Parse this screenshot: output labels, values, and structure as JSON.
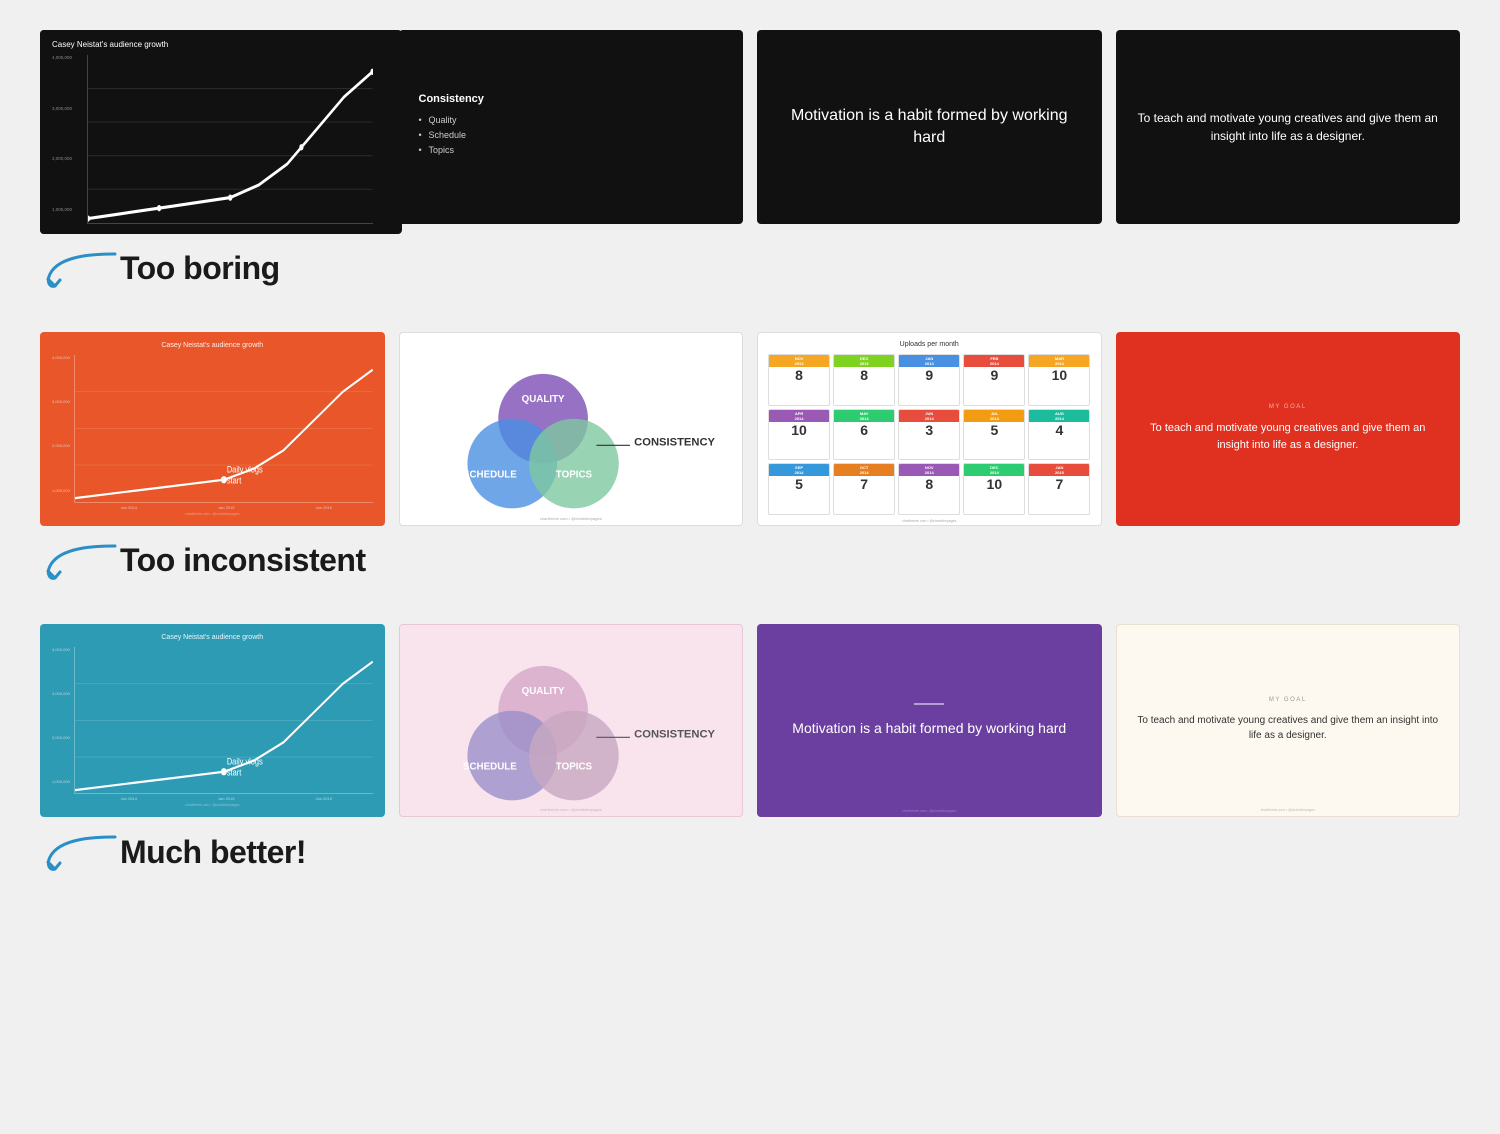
{
  "rows": [
    {
      "id": "row1",
      "slides": [
        {
          "id": "s1-1",
          "type": "chart-black",
          "title": "Casey Neistat's audience growth",
          "yLabels": [
            "4,000,000",
            "3,000,000",
            "2,000,000",
            "1,000,000"
          ]
        },
        {
          "id": "s1-2",
          "type": "bullet-black",
          "title": "Consistency",
          "bullets": [
            "Quality",
            "Schedule",
            "Topics"
          ]
        },
        {
          "id": "s1-3",
          "type": "text-black",
          "text": "Motivation is a habit formed by working hard"
        },
        {
          "id": "s1-4",
          "type": "text-black",
          "text": "To teach and motivate young creatives and give them an insight into life as a designer."
        }
      ],
      "label": "Too boring",
      "labelType": "normal"
    },
    {
      "id": "row2",
      "slides": [
        {
          "id": "s2-1",
          "type": "chart-orange",
          "title": "Casey Neistat's audience growth",
          "dailyLabel": "Daily vlogs start"
        },
        {
          "id": "s2-2",
          "type": "venn-white",
          "labels": [
            "QUALITY",
            "SCHEDULE",
            "TOPICS"
          ],
          "centerLabel": "CONSISTENCY"
        },
        {
          "id": "s2-3",
          "type": "calendar",
          "title": "Uploads per month",
          "cells": [
            {
              "month": "NOV 2013",
              "num": "8",
              "color": "#f5a623"
            },
            {
              "month": "DEC 2013",
              "num": "8",
              "color": "#7ed321"
            },
            {
              "month": "JAN 2014",
              "num": "9",
              "color": "#4a90e2"
            },
            {
              "month": "FEB 2014",
              "num": "9",
              "color": "#e74c3c"
            },
            {
              "month": "MAR 2014",
              "num": "10",
              "color": "#f5a623"
            },
            {
              "month": "APR 2014",
              "num": "10",
              "color": "#9b59b6"
            },
            {
              "month": "MAY 2014",
              "num": "6",
              "color": "#2ecc71"
            },
            {
              "month": "JUN 2014",
              "num": "3",
              "color": "#e74c3c"
            },
            {
              "month": "JUL 2014",
              "num": "5",
              "color": "#f39c12"
            },
            {
              "month": "AUG 2014",
              "num": "4",
              "color": "#1abc9c"
            },
            {
              "month": "SEP 2014",
              "num": "5",
              "color": "#3498db"
            },
            {
              "month": "OCT 2014",
              "num": "7",
              "color": "#e67e22"
            },
            {
              "month": "NOV 2014",
              "num": "8",
              "color": "#9b59b6"
            },
            {
              "month": "DEC 2014",
              "num": "10",
              "color": "#2ecc71"
            },
            {
              "month": "JAN 2015",
              "num": "7",
              "color": "#e74c3c"
            }
          ]
        },
        {
          "id": "s2-4",
          "type": "text-red",
          "goalLabel": "MY GOAL",
          "text": "To teach and motivate young creatives and give them an insight into life as a designer."
        }
      ],
      "label": "Too inconsistent",
      "labelType": "normal"
    },
    {
      "id": "row3",
      "slides": [
        {
          "id": "s3-1",
          "type": "chart-teal",
          "title": "Casey Neistat's audience growth",
          "dailyLabel": "Daily vlogs start"
        },
        {
          "id": "s3-2",
          "type": "venn-pink",
          "labels": [
            "QUALITY",
            "SCHEDULE",
            "TOPICS"
          ],
          "centerLabel": "CONSISTENCY"
        },
        {
          "id": "s3-3",
          "type": "text-purple",
          "text": "Motivation is a habit formed by working hard"
        },
        {
          "id": "s3-4",
          "type": "text-cream",
          "goalLabel": "MY GOAL",
          "text": "To teach and motivate young creatives and give them an insight into life as a designer."
        }
      ],
      "label": "Much better!",
      "labelType": "bold"
    }
  ],
  "arrows": {
    "color": "#2b8fc7"
  }
}
